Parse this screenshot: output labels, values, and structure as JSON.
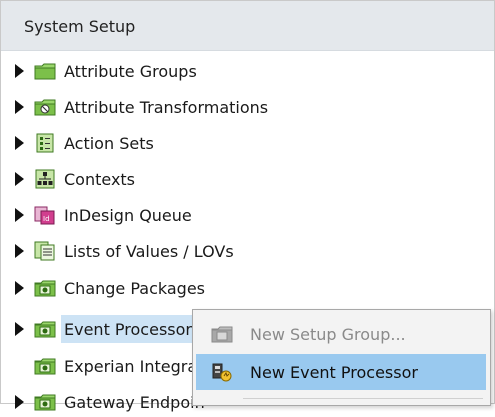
{
  "header": {
    "title": "System Setup"
  },
  "tree": {
    "items": [
      {
        "label": "Attribute Groups",
        "icon": "folder-green-icon"
      },
      {
        "label": "Attribute Transformations",
        "icon": "transformation-icon"
      },
      {
        "label": "Action Sets",
        "icon": "action-set-icon"
      },
      {
        "label": "Contexts",
        "icon": "contexts-icon"
      },
      {
        "label": "InDesign Queue",
        "icon": "indesign-icon"
      },
      {
        "label": "Lists of Values / LOVs",
        "icon": "lov-icon"
      },
      {
        "label": "Change Packages",
        "icon": "setup-group-icon"
      },
      {
        "label": "Event Processors",
        "icon": "setup-group-icon",
        "selected": true
      },
      {
        "label": "Experian Integrat",
        "icon": "setup-group-icon"
      },
      {
        "label": "Gateway Endpoin",
        "icon": "setup-group-icon"
      }
    ]
  },
  "context_menu": {
    "items": [
      {
        "label": "New Setup Group...",
        "icon": "setup-group-icon",
        "disabled": true
      },
      {
        "label": "New Event Processor",
        "icon": "event-processor-icon",
        "hovered": true
      }
    ]
  },
  "colors": {
    "header_bg": "#e4e8ec",
    "selected_bg": "#cde3f5",
    "menu_hover": "#99c9ef",
    "folder_green": "#7cc04a"
  }
}
